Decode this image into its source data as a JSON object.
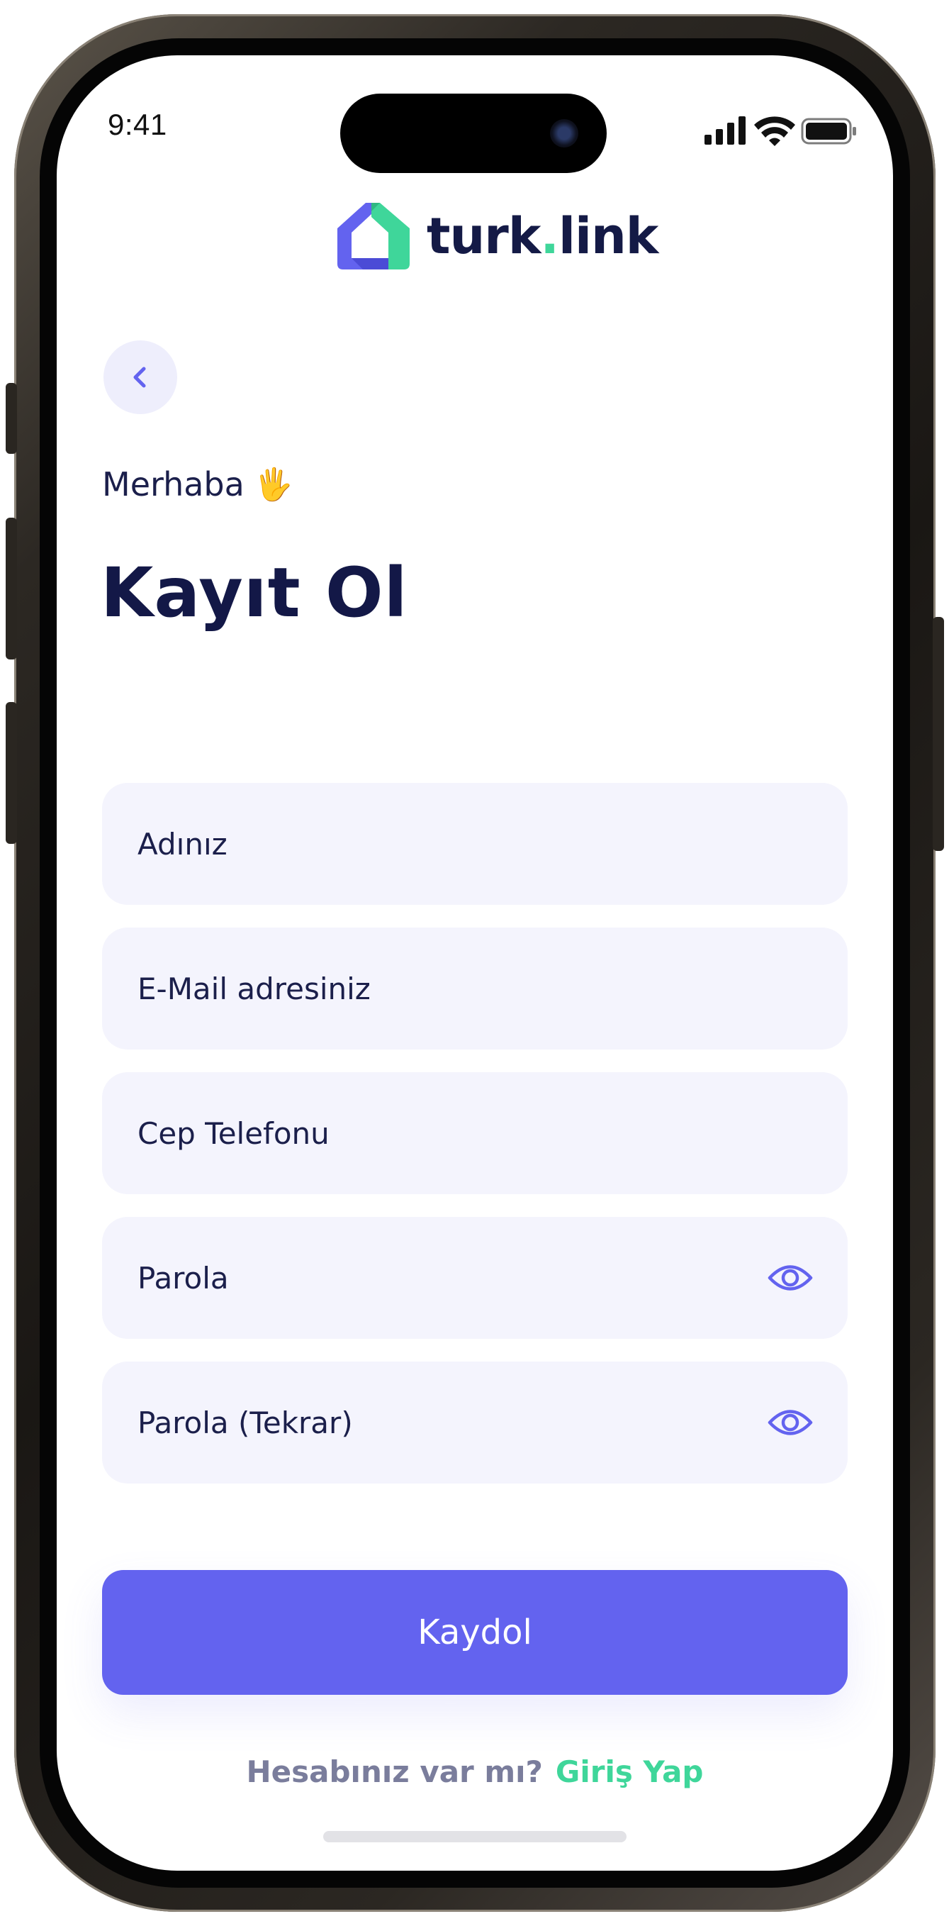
{
  "status_bar": {
    "time": "9:41"
  },
  "brand": {
    "name_main": "turk",
    "name_dot": ".",
    "name_tld": "link",
    "accent_purple": "#6363ef",
    "accent_green": "#3fd69a"
  },
  "header": {
    "greeting": "Merhaba",
    "greeting_emoji": "🖐",
    "title": "Kayıt Ol"
  },
  "form": {
    "name_placeholder": "Adınız",
    "email_placeholder": "E-Mail adresiniz",
    "phone_placeholder": "Cep Telefonu",
    "password_placeholder": "Parola",
    "password_repeat_placeholder": "Parola (Tekrar)"
  },
  "actions": {
    "submit_label": "Kaydol",
    "signin_question": "Hesabınız var mı?",
    "signin_link": "Giriş Yap"
  },
  "icons": {
    "back": "chevron-left-icon",
    "password_toggle": "eye-icon"
  }
}
